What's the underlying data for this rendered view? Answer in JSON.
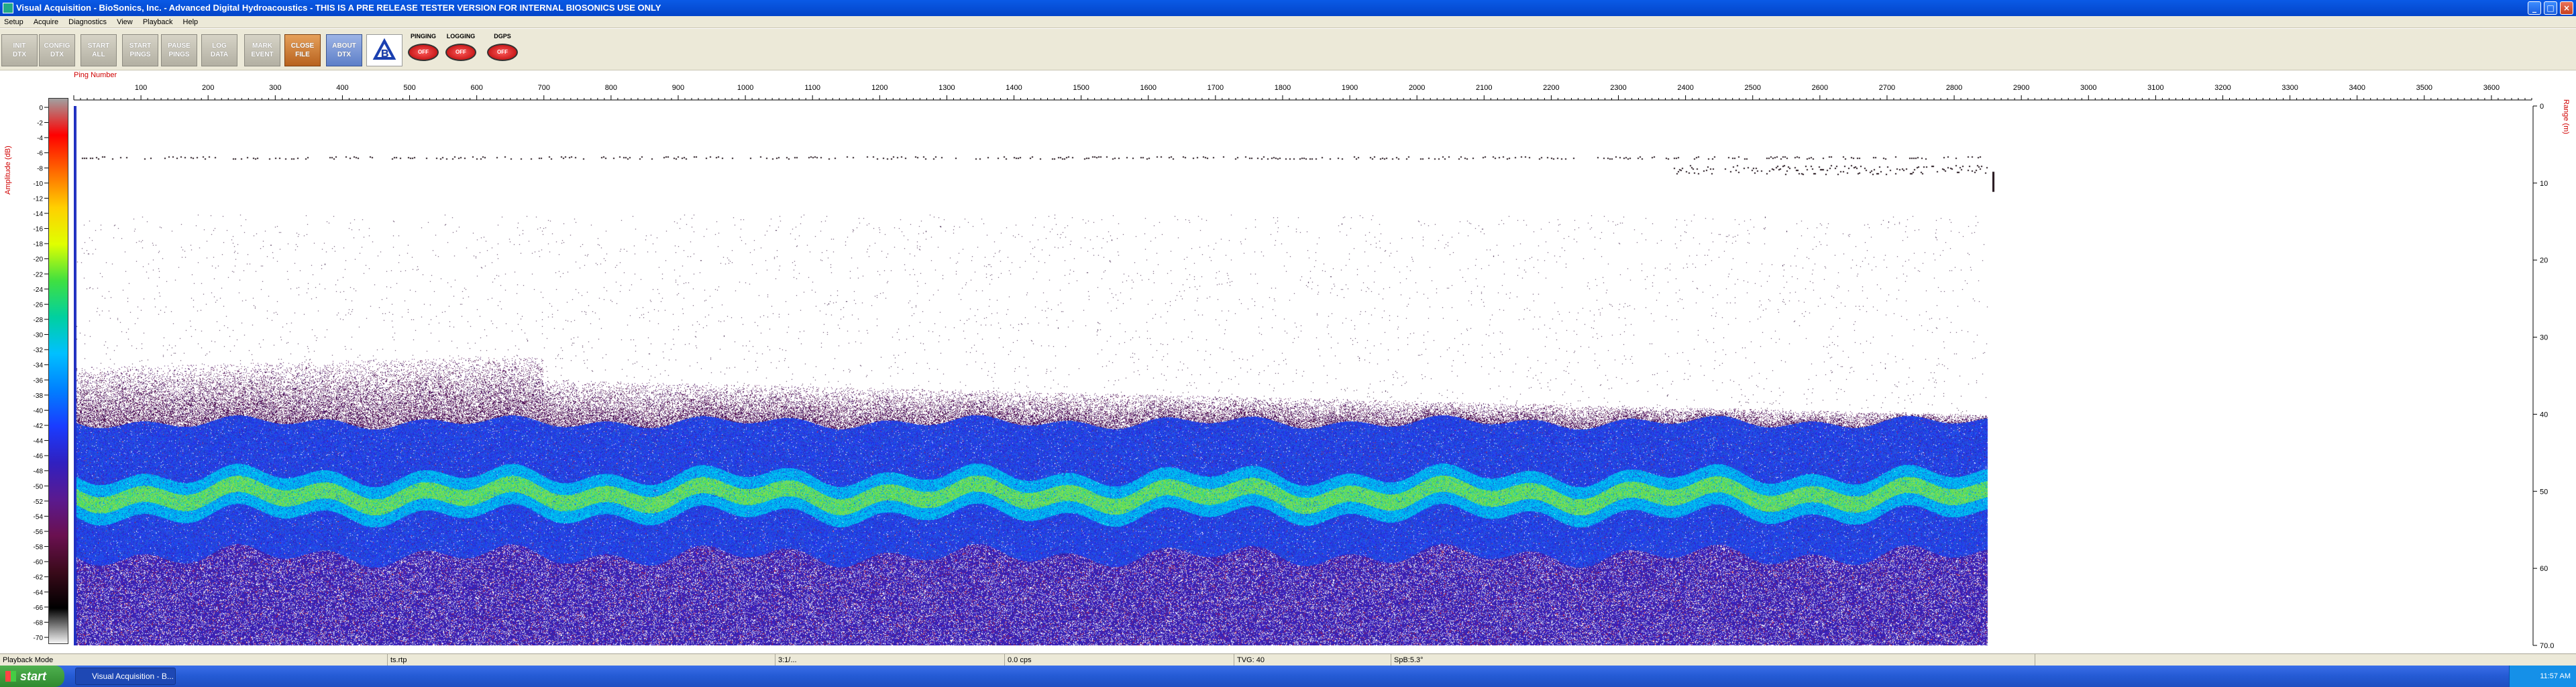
{
  "window": {
    "title": "Visual Acquisition  -  BioSonics, Inc.  -  Advanced Digital Hydroacoustics  -  THIS IS A PRE RELEASE TESTER VERSION FOR INTERNAL BIOSONICS USE ONLY",
    "minimize": "_",
    "maximize": "□",
    "close": "×"
  },
  "menu": [
    "Setup",
    "Acquire",
    "Diagnostics",
    "View",
    "Playback",
    "Help"
  ],
  "toolbar": {
    "buttons": [
      {
        "l1": "INIT",
        "l2": "DTX"
      },
      {
        "l1": "CONFIG",
        "l2": "DTX"
      },
      {
        "l1": "START",
        "l2": "ALL"
      },
      {
        "l1": "START",
        "l2": "PINGS"
      },
      {
        "l1": "PAUSE",
        "l2": "PINGS"
      },
      {
        "l1": "LOG",
        "l2": "DATA"
      },
      {
        "l1": "MARK",
        "l2": "EVENT"
      },
      {
        "l1": "CLOSE",
        "l2": "FILE"
      },
      {
        "l1": "ABOUT",
        "l2": "DTX"
      }
    ],
    "logo": "B",
    "indicators": [
      {
        "label": "PINGING",
        "state": "OFF"
      },
      {
        "label": "LOGGING",
        "state": "OFF"
      },
      {
        "label": "DGPS",
        "state": "OFF"
      }
    ]
  },
  "ping_axis": {
    "label": "Ping Number",
    "ticks": [
      100,
      200,
      300,
      400,
      500,
      600,
      700,
      800,
      900,
      1000,
      1100,
      1200,
      1300,
      1400,
      1500,
      1600,
      1700,
      1800,
      1900,
      2000,
      2100,
      2200,
      2300,
      2400,
      2500,
      2600,
      2700,
      2800,
      2900,
      3000,
      3100,
      3200,
      3300,
      3400,
      3500,
      3600
    ],
    "max": 3660,
    "data_end": 2850
  },
  "amplitude_scale": {
    "label": "Amplitude (dB)",
    "ticks": [
      0,
      -2,
      -4,
      -6,
      -8,
      -10,
      -12,
      -14,
      -16,
      -18,
      -20,
      -22,
      -24,
      -26,
      -28,
      -30,
      -32,
      -34,
      -36,
      -38,
      -40,
      -42,
      -44,
      -46,
      -48,
      -50,
      -52,
      -54,
      -56,
      -58,
      -60,
      -62,
      -64,
      -66,
      -68,
      -70
    ]
  },
  "range_axis": {
    "label": "Range (m)",
    "ticks": [
      "0",
      "10",
      "20",
      "30",
      "40",
      "50",
      "60",
      "70.0"
    ],
    "max": 70
  },
  "status": {
    "mode": "Playback Mode",
    "file": "ts.rtp",
    "time": "3:1/...",
    "rate": "0.0 cps",
    "tvg": "TVG: 40",
    "spb": "SpB:5.3°"
  },
  "taskbar": {
    "start": "start",
    "app": "Visual Acquisition - B...",
    "clock": "11:57 AM"
  },
  "colors": {
    "titlebar": "#0a5ae6",
    "axis_label": "#d00000",
    "echo_low": "#1a1a9a",
    "echo_mid": "#00a0ff",
    "echo_high": "#40e040"
  }
}
